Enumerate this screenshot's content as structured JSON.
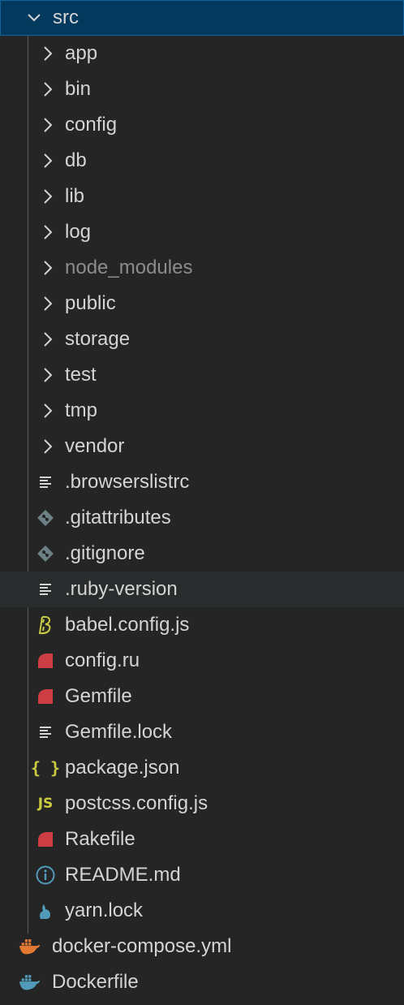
{
  "explorer": {
    "root": {
      "label": "src",
      "icon": "chevron-down-icon"
    },
    "folders": [
      {
        "label": "app"
      },
      {
        "label": "bin"
      },
      {
        "label": "config"
      },
      {
        "label": "db"
      },
      {
        "label": "lib"
      },
      {
        "label": "log"
      },
      {
        "label": "node_modules",
        "dimmed": true
      },
      {
        "label": "public"
      },
      {
        "label": "storage"
      },
      {
        "label": "test"
      },
      {
        "label": "tmp"
      },
      {
        "label": "vendor"
      }
    ],
    "files": [
      {
        "label": ".browserslistrc",
        "icon": "text-file-icon"
      },
      {
        "label": ".gitattributes",
        "icon": "git-icon"
      },
      {
        "label": ".gitignore",
        "icon": "git-icon"
      },
      {
        "label": ".ruby-version",
        "icon": "text-file-icon",
        "hovered": true
      },
      {
        "label": "babel.config.js",
        "icon": "babel-icon"
      },
      {
        "label": "config.ru",
        "icon": "ruby-icon"
      },
      {
        "label": "Gemfile",
        "icon": "ruby-icon"
      },
      {
        "label": "Gemfile.lock",
        "icon": "text-file-icon"
      },
      {
        "label": "package.json",
        "icon": "json-icon",
        "glyph": "{ }"
      },
      {
        "label": "postcss.config.js",
        "icon": "javascript-icon",
        "glyph": "JS"
      },
      {
        "label": "Rakefile",
        "icon": "ruby-icon"
      },
      {
        "label": "README.md",
        "icon": "info-icon",
        "glyph": "i"
      },
      {
        "label": "yarn.lock",
        "icon": "yarn-icon"
      }
    ],
    "siblings": [
      {
        "label": "docker-compose.yml",
        "icon": "docker-icon"
      },
      {
        "label": "Dockerfile",
        "icon": "docker-icon"
      }
    ]
  },
  "colors": {
    "background": "#252526",
    "selected_bg": "#04395e",
    "selected_border": "#0e639c",
    "hover_bg": "#2a2d2e",
    "text": "#d4d4d4",
    "dimmed_text": "#8c8c8c",
    "ruby": "#cc3e44",
    "babel": "#cbcb41",
    "json": "#cbcb41",
    "javascript": "#cbcb41",
    "info": "#519aba",
    "docker_compose": "#e37933",
    "docker": "#519aba",
    "yarn": "#519aba",
    "git": "#6d8086"
  }
}
